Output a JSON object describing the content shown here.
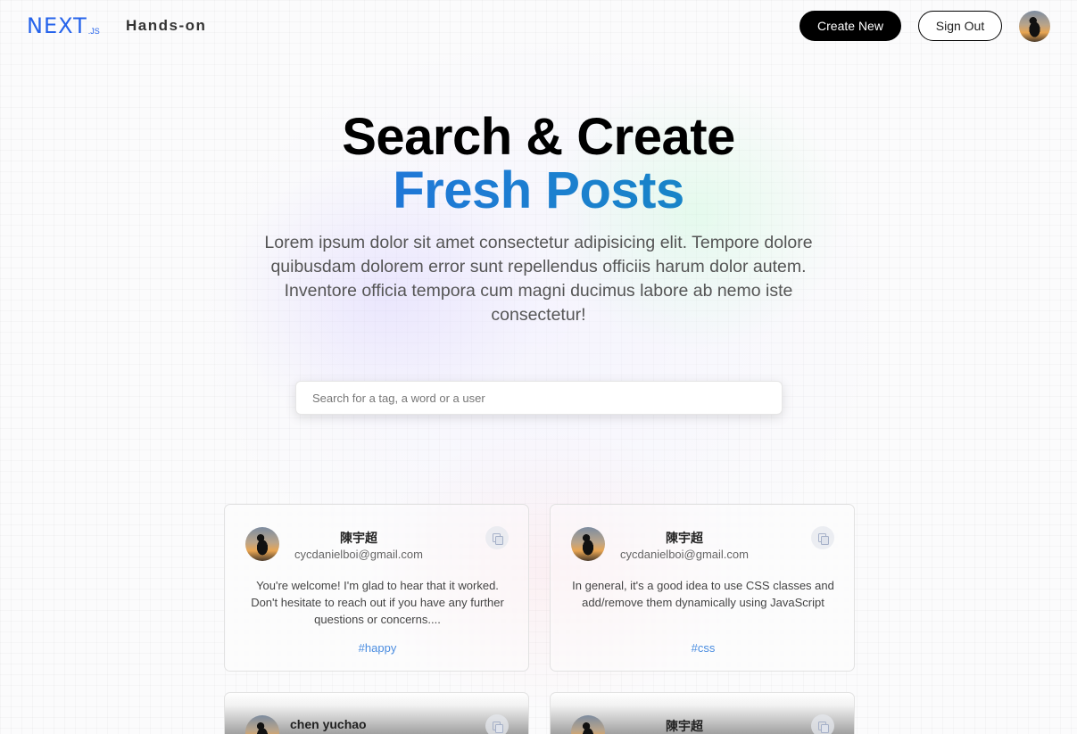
{
  "nav": {
    "logo_text": "NEXT",
    "logo_suffix": ".JS",
    "brand": "Hands-on",
    "create_label": "Create New",
    "signout_label": "Sign Out"
  },
  "hero": {
    "title_line1": "Search & Create",
    "title_line2": "Fresh Posts",
    "description": "Lorem ipsum dolor sit amet consectetur adipisicing elit. Tempore dolore quibusdam dolorem error sunt repellendus officiis harum dolor autem. Inventore officia tempora cum magni ducimus labore ab nemo iste consectetur!"
  },
  "search": {
    "placeholder": "Search for a tag, a word or a user"
  },
  "posts": [
    {
      "name": "陳宇超",
      "email": "cycdanielboi@gmail.com",
      "body": "You're welcome! I'm glad to hear that it worked. Don't hesitate to reach out if you have any further questions or concerns....",
      "tag": "#happy"
    },
    {
      "name": "陳宇超",
      "email": "cycdanielboi@gmail.com",
      "body": "In general, it's a good idea to use CSS classes and add/remove them dynamically using JavaScript",
      "tag": "#css"
    },
    {
      "name": "chen yuchao",
      "email": "",
      "body": "",
      "tag": ""
    },
    {
      "name": "陳宇超",
      "email": "",
      "body": "",
      "tag": ""
    }
  ]
}
